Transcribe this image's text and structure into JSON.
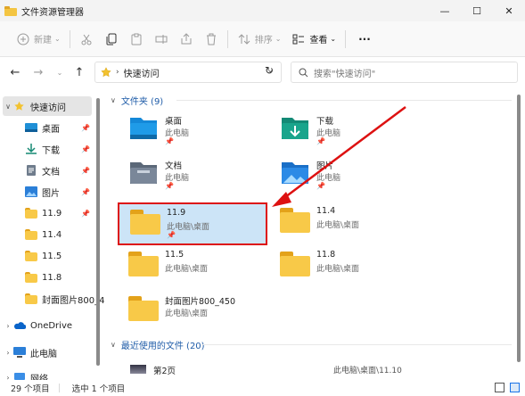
{
  "window": {
    "title": "文件资源管理器",
    "min": "—",
    "max": "☐",
    "close": "✕"
  },
  "toolbar": {
    "new_label": "新建",
    "sort_label": "排序",
    "view_label": "查看",
    "more": "···"
  },
  "address": {
    "location": "快速访问",
    "search_placeholder": "搜索\"快速访问\""
  },
  "sidebar": {
    "items": [
      {
        "label": "快速访问",
        "icon": "star-icon",
        "expander": "∨",
        "selected": true
      },
      {
        "label": "桌面",
        "icon": "desktop-icon",
        "pinned": true
      },
      {
        "label": "下载",
        "icon": "download-icon",
        "pinned": true
      },
      {
        "label": "文档",
        "icon": "document-icon",
        "pinned": true
      },
      {
        "label": "图片",
        "icon": "picture-icon",
        "pinned": true
      },
      {
        "label": "11.9",
        "icon": "folder-icon",
        "pinned": true
      },
      {
        "label": "11.4",
        "icon": "folder-icon"
      },
      {
        "label": "11.5",
        "icon": "folder-icon"
      },
      {
        "label": "11.8",
        "icon": "folder-icon"
      },
      {
        "label": "封面图片800_4",
        "icon": "folder-icon"
      },
      {
        "label": "OneDrive",
        "icon": "cloud-icon",
        "expander": "›"
      },
      {
        "label": "此电脑",
        "icon": "computer-icon",
        "expander": "›"
      },
      {
        "label": "网络",
        "icon": "network-icon",
        "expander": "›"
      }
    ]
  },
  "main": {
    "folders_header": "文件夹 (9)",
    "recent_header": "最近使用的文件 (20)",
    "tiles": [
      {
        "name": "桌面",
        "location": "此电脑",
        "pinned": true,
        "icon": "desktop-icon"
      },
      {
        "name": "下载",
        "location": "此电脑",
        "pinned": true,
        "icon": "download-icon"
      },
      {
        "name": "文档",
        "location": "此电脑",
        "pinned": true,
        "icon": "document-icon"
      },
      {
        "name": "图片",
        "location": "此电脑",
        "pinned": true,
        "icon": "picture-icon"
      },
      {
        "name": "11.9",
        "location": "此电脑\\桌面",
        "pinned": true,
        "selected": true,
        "icon": "folder-icon"
      },
      {
        "name": "11.4",
        "location": "此电脑\\桌面",
        "icon": "folder-icon"
      },
      {
        "name": "11.5",
        "location": "此电脑\\桌面",
        "icon": "folder-icon"
      },
      {
        "name": "11.8",
        "location": "此电脑\\桌面",
        "icon": "folder-icon"
      },
      {
        "name": "封面图片800_450",
        "location": "此电脑\\桌面",
        "icon": "folder-icon"
      }
    ],
    "recent": [
      {
        "name": "第2页",
        "location": "此电脑\\桌面\\11.10"
      }
    ]
  },
  "status": {
    "count": "29 个项目",
    "selected": "选中 1 个项目"
  },
  "colors": {
    "accent": "#0067c0",
    "selection": "#cce4f7",
    "annotation": "#dd1111",
    "folder": "#f8c948"
  }
}
